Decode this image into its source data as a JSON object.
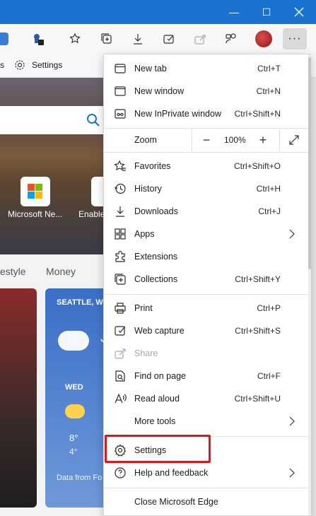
{
  "window": {
    "minimize": "—",
    "maximize": "☐"
  },
  "favorites_bar": {
    "settings_label": "Settings",
    "partial_left": "s"
  },
  "page": {
    "tiles": [
      "Microsoft Ne...",
      "Enable"
    ],
    "tabs": [
      "estyle",
      "Money"
    ],
    "weather": {
      "city": "SEATTLE, W",
      "temp_partial": "J",
      "day": "WED",
      "high": "8°",
      "low": "4°",
      "footer": "Data from Fo"
    }
  },
  "menu": {
    "items_top": [
      {
        "label": "New tab",
        "shortcut": "Ctrl+T",
        "icon": "new-tab-icon"
      },
      {
        "label": "New window",
        "shortcut": "Ctrl+N",
        "icon": "new-window-icon"
      },
      {
        "label": "New InPrivate window",
        "shortcut": "Ctrl+Shift+N",
        "icon": "inprivate-icon"
      }
    ],
    "zoom": {
      "label": "Zoom",
      "value": "100%",
      "minus": "−",
      "plus": "+"
    },
    "items_mid": [
      {
        "label": "Favorites",
        "shortcut": "Ctrl+Shift+O",
        "icon": "favorites-icon"
      },
      {
        "label": "History",
        "shortcut": "Ctrl+H",
        "icon": "history-icon"
      },
      {
        "label": "Downloads",
        "shortcut": "Ctrl+J",
        "icon": "downloads-icon"
      },
      {
        "label": "Apps",
        "shortcut": "",
        "icon": "apps-icon",
        "submenu": true
      },
      {
        "label": "Extensions",
        "shortcut": "",
        "icon": "extensions-icon"
      },
      {
        "label": "Collections",
        "shortcut": "Ctrl+Shift+Y",
        "icon": "collections-icon"
      }
    ],
    "items_tools": [
      {
        "label": "Print",
        "shortcut": "Ctrl+P",
        "icon": "print-icon"
      },
      {
        "label": "Web capture",
        "shortcut": "Ctrl+Shift+S",
        "icon": "web-capture-icon"
      },
      {
        "label": "Share",
        "shortcut": "",
        "icon": "share-icon",
        "disabled": true
      },
      {
        "label": "Find on page",
        "shortcut": "Ctrl+F",
        "icon": "find-icon"
      },
      {
        "label": "Read aloud",
        "shortcut": "Ctrl+Shift+U",
        "icon": "read-aloud-icon"
      },
      {
        "label": "More tools",
        "shortcut": "",
        "icon": "",
        "submenu": true
      }
    ],
    "items_bottom": [
      {
        "label": "Settings",
        "shortcut": "",
        "icon": "settings-icon",
        "highlighted": true
      },
      {
        "label": "Help and feedback",
        "shortcut": "",
        "icon": "help-icon",
        "submenu": true
      }
    ],
    "close": {
      "label": "Close Microsoft Edge"
    }
  },
  "colors": {
    "titlebar": "#1a73d1",
    "highlight": "#e0161b"
  }
}
